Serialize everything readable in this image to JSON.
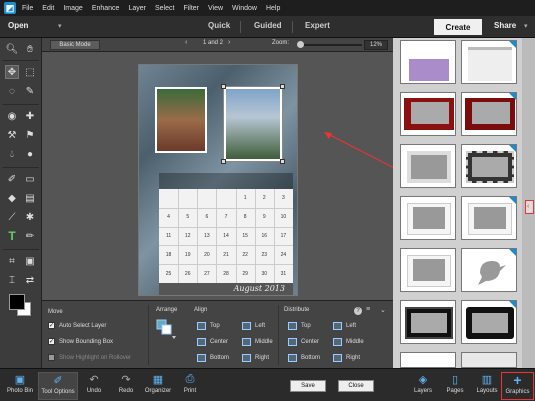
{
  "app": {
    "logo": "photoshop-elements-logo"
  },
  "menu": [
    "File",
    "Edit",
    "Image",
    "Enhance",
    "Layer",
    "Select",
    "Filter",
    "View",
    "Window",
    "Help"
  ],
  "modebar": {
    "open": "Open",
    "modes": [
      "Quick",
      "Guided",
      "Expert"
    ],
    "create": "Create",
    "share": "Share"
  },
  "options": {
    "basic_mode": "Basic Mode",
    "page_nav": "1 and 2",
    "zoom_label": "Zoom:",
    "zoom_value": "12%",
    "zoom_level": 0.12
  },
  "calendar": {
    "title": "August  2013",
    "days": [
      "1",
      "2",
      "3",
      "4",
      "5",
      "6",
      "7",
      "8",
      "9",
      "10",
      "11",
      "12",
      "13",
      "14",
      "15",
      "16",
      "17",
      "18",
      "19",
      "20",
      "21",
      "22",
      "23",
      "24",
      "25",
      "26",
      "27",
      "28",
      "29",
      "30",
      "31"
    ]
  },
  "panel": {
    "move": {
      "title": "Move",
      "auto_select": "Auto Select Layer",
      "bounding_box": "Show Bounding Box",
      "highlight": "Show Highlight on Rollover"
    },
    "arrange": {
      "title": "Arrange"
    },
    "align": {
      "title": "Align",
      "items": [
        "Top",
        "Left",
        "Center",
        "Middle",
        "Bottom",
        "Right"
      ]
    },
    "distribute": {
      "title": "Distribute",
      "items": [
        "Top",
        "Left",
        "Center",
        "Middle",
        "Bottom",
        "Right"
      ]
    },
    "help": "?"
  },
  "bottombar": {
    "photo_bin": "Photo Bin",
    "tool_options": "Tool Options",
    "undo": "Undo",
    "redo": "Redo",
    "organizer": "Organizer",
    "print": "Print",
    "save": "Save",
    "close": "Close",
    "layers": "Layers",
    "pages": "Pages",
    "layouts": "Layouts",
    "graphics": "Graphics"
  },
  "colors": {
    "accent": "#1b8ad0",
    "highlight": "#e33333"
  }
}
